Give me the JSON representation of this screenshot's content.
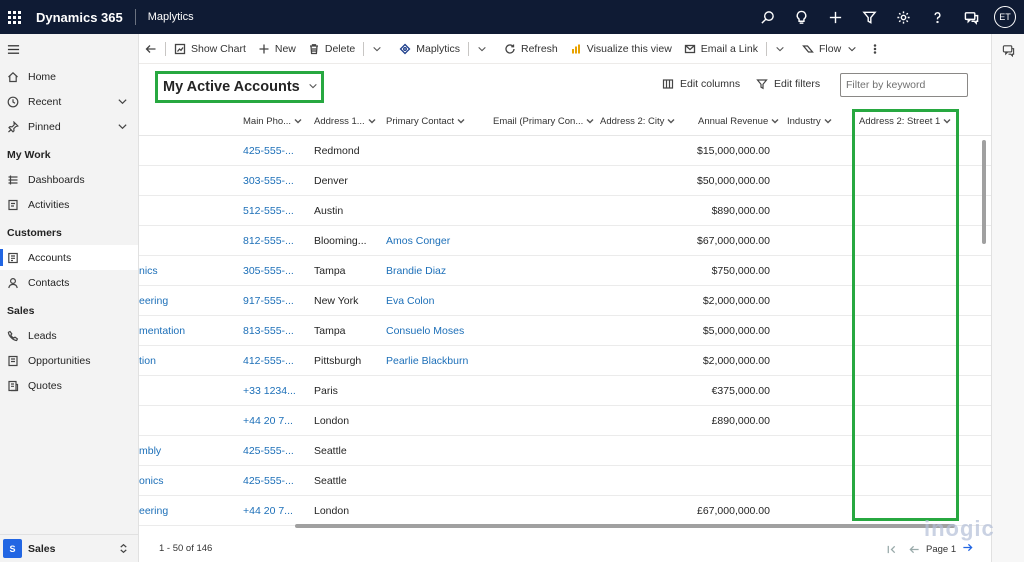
{
  "topbar": {
    "brand": "Dynamics 365",
    "app_name": "Maplytics",
    "avatar_initials": "ET",
    "icons": [
      "search-icon",
      "lightbulb-icon",
      "plus-icon",
      "filter-icon",
      "gear-icon",
      "help-icon",
      "chat-icon"
    ]
  },
  "sidebar": {
    "top_items": [
      {
        "label": "Home",
        "icon": "home-icon"
      },
      {
        "label": "Recent",
        "icon": "clock-icon",
        "expandable": true
      },
      {
        "label": "Pinned",
        "icon": "pin-icon",
        "expandable": true
      }
    ],
    "groups": [
      {
        "title": "My Work",
        "items": [
          {
            "label": "Dashboards",
            "icon": "dashboard-icon"
          },
          {
            "label": "Activities",
            "icon": "activities-icon"
          }
        ]
      },
      {
        "title": "Customers",
        "items": [
          {
            "label": "Accounts",
            "icon": "accounts-icon",
            "active": true
          },
          {
            "label": "Contacts",
            "icon": "contact-icon"
          }
        ]
      },
      {
        "title": "Sales",
        "items": [
          {
            "label": "Leads",
            "icon": "phone-icon"
          },
          {
            "label": "Opportunities",
            "icon": "opportunity-icon"
          },
          {
            "label": "Quotes",
            "icon": "quote-icon"
          }
        ]
      }
    ],
    "area": {
      "badge": "S",
      "label": "Sales"
    }
  },
  "commandbar": {
    "show_chart": "Show Chart",
    "new": "New",
    "delete": "Delete",
    "maplytics": "Maplytics",
    "refresh": "Refresh",
    "visualize": "Visualize this view",
    "email_link": "Email a Link",
    "flow": "Flow"
  },
  "view": {
    "title": "My Active Accounts",
    "edit_columns": "Edit columns",
    "edit_filters": "Edit filters",
    "filter_placeholder": "Filter by keyword"
  },
  "grid": {
    "columns": {
      "main_phone": "Main Pho...",
      "address1": "Address 1...",
      "primary_contact": "Primary Contact",
      "email": "Email (Primary Con...",
      "address2_city": "Address 2: City",
      "annual_revenue": "Annual Revenue",
      "industry": "Industry",
      "address2_street1": "Address 2: Street 1"
    },
    "rows": [
      {
        "name": "",
        "phone": "425-555-...",
        "city": "Redmond",
        "contact": "",
        "revenue": "$15,000,000.00"
      },
      {
        "name": "",
        "phone": "303-555-...",
        "city": "Denver",
        "contact": "",
        "revenue": "$50,000,000.00"
      },
      {
        "name": "",
        "phone": "512-555-...",
        "city": "Austin",
        "contact": "",
        "revenue": "$890,000.00"
      },
      {
        "name": "",
        "phone": "812-555-...",
        "city": "Blooming...",
        "contact": "Amos Conger",
        "revenue": "$67,000,000.00"
      },
      {
        "name": "nics",
        "phone": "305-555-...",
        "city": "Tampa",
        "contact": "Brandie Diaz",
        "revenue": "$750,000.00"
      },
      {
        "name": "eering",
        "phone": "917-555-...",
        "city": "New York",
        "contact": "Eva Colon",
        "revenue": "$2,000,000.00"
      },
      {
        "name": "mentation",
        "phone": "813-555-...",
        "city": "Tampa",
        "contact": "Consuelo Moses",
        "revenue": "$5,000,000.00"
      },
      {
        "name": "tion",
        "phone": "412-555-...",
        "city": "Pittsburgh",
        "contact": "Pearlie Blackburn",
        "revenue": "$2,000,000.00"
      },
      {
        "name": "",
        "phone": "+33 1234...",
        "city": "Paris",
        "contact": "",
        "revenue": "€375,000.00"
      },
      {
        "name": "",
        "phone": "+44 20 7...",
        "city": "London",
        "contact": "",
        "revenue": "£890,000.00"
      },
      {
        "name": "mbly",
        "phone": "425-555-...",
        "city": "Seattle",
        "contact": "",
        "revenue": ""
      },
      {
        "name": "onics",
        "phone": "425-555-...",
        "city": "Seattle",
        "contact": "",
        "revenue": ""
      },
      {
        "name": "eering",
        "phone": "+44 20 7...",
        "city": "London",
        "contact": "",
        "revenue": "£67,000,000.00"
      }
    ]
  },
  "footer": {
    "count": "1 - 50 of 146",
    "page": "Page 1"
  },
  "watermark": "inogic",
  "colors": {
    "topbar": "#0f1b34",
    "accent": "#2266e3",
    "highlight": "#27a840",
    "link": "#1c6fb8"
  }
}
